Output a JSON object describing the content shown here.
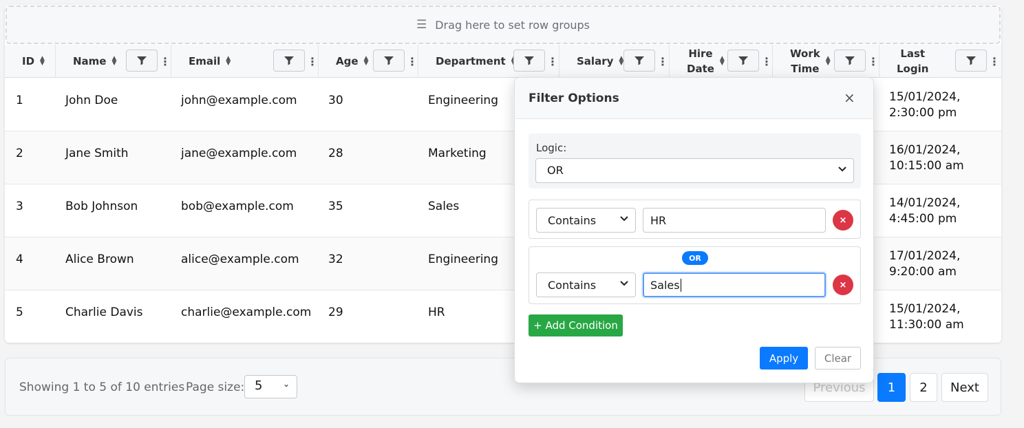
{
  "group_bar": {
    "icon": "menu-icon",
    "text": "Drag here to set row groups"
  },
  "columns": [
    {
      "key": "id",
      "label": "ID",
      "filterable": false
    },
    {
      "key": "name",
      "label": "Name",
      "filterable": true
    },
    {
      "key": "email",
      "label": "Email",
      "filterable": true
    },
    {
      "key": "age",
      "label": "Age",
      "filterable": true
    },
    {
      "key": "department",
      "label": "Department",
      "filterable": true
    },
    {
      "key": "salary",
      "label": "Salary",
      "filterable": true
    },
    {
      "key": "hire_date",
      "label": "Hire Date",
      "label_lines": [
        "Hire",
        "Date"
      ],
      "filterable": true
    },
    {
      "key": "work_time",
      "label": "Work Time",
      "label_lines": [
        "Work",
        "Time"
      ],
      "filterable": true
    },
    {
      "key": "last_login",
      "label": "Last Login",
      "label_lines": [
        "Last",
        "Login"
      ],
      "filterable": true
    }
  ],
  "rows": [
    {
      "id": "1",
      "name": "John Doe",
      "email": "john@example.com",
      "age": "30",
      "department": "Engineering",
      "last_login": [
        "15/01/2024,",
        "2:30:00 pm"
      ]
    },
    {
      "id": "2",
      "name": "Jane Smith",
      "email": "jane@example.com",
      "age": "28",
      "department": "Marketing",
      "last_login": [
        "16/01/2024,",
        "10:15:00 am"
      ]
    },
    {
      "id": "3",
      "name": "Bob Johnson",
      "email": "bob@example.com",
      "age": "35",
      "department": "Sales",
      "last_login": [
        "14/01/2024,",
        "4:45:00 pm"
      ]
    },
    {
      "id": "4",
      "name": "Alice Brown",
      "email": "alice@example.com",
      "age": "32",
      "department": "Engineering",
      "last_login": [
        "17/01/2024,",
        "9:20:00 am"
      ]
    },
    {
      "id": "5",
      "name": "Charlie Davis",
      "email": "charlie@example.com",
      "age": "29",
      "department": "HR",
      "last_login": [
        "15/01/2024,",
        "11:30:00 am"
      ]
    }
  ],
  "pagination": {
    "info": "Showing 1 to 5 of 10 entries",
    "page_size_label": "Page size:",
    "page_size": "5",
    "previous": "Previous",
    "pages": [
      "1",
      "2"
    ],
    "active_page": "1",
    "next": "Next"
  },
  "filter_popup": {
    "title": "Filter Options",
    "close": "×",
    "logic_label": "Logic:",
    "logic_value": "OR",
    "conditions": [
      {
        "operator": "Contains",
        "value": "HR"
      },
      {
        "operator": "Contains",
        "value": "Sales",
        "connector": "OR"
      }
    ],
    "remove_icon": "×",
    "add_condition": "+ Add Condition",
    "apply": "Apply",
    "clear": "Clear"
  },
  "colors": {
    "primary": "#0a7aff",
    "success": "#28a745",
    "danger": "#dc3545"
  }
}
